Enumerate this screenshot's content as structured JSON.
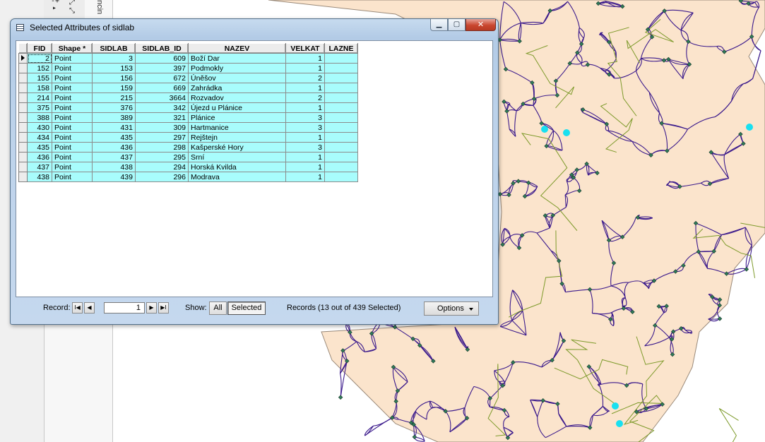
{
  "window": {
    "title": "Selected Attributes of sidlab",
    "close_glyph": "✕",
    "min_glyph": "▁",
    "max_glyph": "▢",
    "icon": "table-icon"
  },
  "table": {
    "columns": [
      "FID",
      "Shape *",
      "SIDLAB",
      "SIDLAB_ID",
      "NAZEV",
      "VELKAT",
      "LAZNE"
    ],
    "rows": [
      {
        "fid": "2",
        "shape": "Point",
        "sidlab": "3",
        "sidlab_id": "609",
        "nazev": "Boží Dar",
        "velkat": "1",
        "lazne": ""
      },
      {
        "fid": "152",
        "shape": "Point",
        "sidlab": "153",
        "sidlab_id": "397",
        "nazev": "Podmokly",
        "velkat": "1",
        "lazne": ""
      },
      {
        "fid": "155",
        "shape": "Point",
        "sidlab": "156",
        "sidlab_id": "672",
        "nazev": "Úněšov",
        "velkat": "2",
        "lazne": ""
      },
      {
        "fid": "158",
        "shape": "Point",
        "sidlab": "159",
        "sidlab_id": "669",
        "nazev": "Zahrádka",
        "velkat": "1",
        "lazne": ""
      },
      {
        "fid": "214",
        "shape": "Point",
        "sidlab": "215",
        "sidlab_id": "3664",
        "nazev": "Rozvadov",
        "velkat": "2",
        "lazne": ""
      },
      {
        "fid": "375",
        "shape": "Point",
        "sidlab": "376",
        "sidlab_id": "342",
        "nazev": "Újezd u Plánice",
        "velkat": "1",
        "lazne": ""
      },
      {
        "fid": "388",
        "shape": "Point",
        "sidlab": "389",
        "sidlab_id": "321",
        "nazev": "Plánice",
        "velkat": "3",
        "lazne": ""
      },
      {
        "fid": "430",
        "shape": "Point",
        "sidlab": "431",
        "sidlab_id": "309",
        "nazev": "Hartmanice",
        "velkat": "3",
        "lazne": ""
      },
      {
        "fid": "434",
        "shape": "Point",
        "sidlab": "435",
        "sidlab_id": "297",
        "nazev": "Rejštejn",
        "velkat": "1",
        "lazne": ""
      },
      {
        "fid": "435",
        "shape": "Point",
        "sidlab": "436",
        "sidlab_id": "298",
        "nazev": "Kašperské Hory",
        "velkat": "3",
        "lazne": ""
      },
      {
        "fid": "436",
        "shape": "Point",
        "sidlab": "437",
        "sidlab_id": "295",
        "nazev": "Srní",
        "velkat": "1",
        "lazne": ""
      },
      {
        "fid": "437",
        "shape": "Point",
        "sidlab": "438",
        "sidlab_id": "294",
        "nazev": "Horská Kvilda",
        "velkat": "1",
        "lazne": ""
      },
      {
        "fid": "438",
        "shape": "Point",
        "sidlab": "439",
        "sidlab_id": "296",
        "nazev": "Modrava",
        "velkat": "1",
        "lazne": ""
      }
    ]
  },
  "statusbar": {
    "record_label": "Record:",
    "record_value": "1",
    "first_glyph": "I◀",
    "prev_glyph": "◀",
    "next_glyph": "▶",
    "last_glyph": "▶I",
    "show_label": "Show:",
    "all_label": "All",
    "selected_label": "Selected",
    "records_text": "Records (13 out of 439 Selected)",
    "options_label": "Options"
  },
  "map": {
    "land_color": "#fbe4cc",
    "road_color": "#3b1a8c",
    "river_color": "#7d9a2a",
    "point_color": "#2f7a5a",
    "selected_point_color": "#18e0f0"
  },
  "left_panel": {
    "vertical_tab_text": "ncin"
  }
}
